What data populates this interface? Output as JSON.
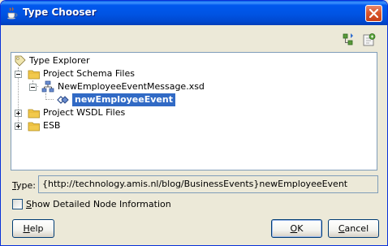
{
  "window": {
    "title": "Type Chooser",
    "title_icon": "coffee-cup-icon",
    "close_icon": "close-x-icon"
  },
  "toolbar": {
    "buttons": [
      {
        "icon": "expand-tree-icon"
      },
      {
        "icon": "refresh-icon"
      }
    ]
  },
  "tree": {
    "root": {
      "label": "Type Explorer",
      "icon": "type-explorer-icon"
    },
    "nodes": [
      {
        "label": "Project Schema Files",
        "icon": "folder-icon",
        "expanded": true
      },
      {
        "label": "NewEmployeeEventMessage.xsd",
        "icon": "schema-file-icon",
        "expanded": true
      },
      {
        "label": "newEmployeeEvent",
        "icon": "element-icon",
        "selected": true
      },
      {
        "label": "Project WSDL Files",
        "icon": "folder-icon",
        "expanded": false
      },
      {
        "label": "ESB",
        "icon": "folder-icon",
        "expanded": false
      }
    ]
  },
  "type_field": {
    "label_prefix": "",
    "label_mnemonic": "T",
    "label_rest": "ype:",
    "value": "{http://technology.amis.nl/blog/BusinessEvents}newEmployeeEvent"
  },
  "detail_checkbox": {
    "label_mnemonic": "S",
    "label_rest": "how Detailed Node Information",
    "checked": false
  },
  "buttons": {
    "help": {
      "mnemonic": "H",
      "rest": "elp"
    },
    "ok": {
      "mnemonic": "O",
      "rest": "K"
    },
    "cancel": {
      "mnemonic": "C",
      "rest": "ancel"
    }
  }
}
